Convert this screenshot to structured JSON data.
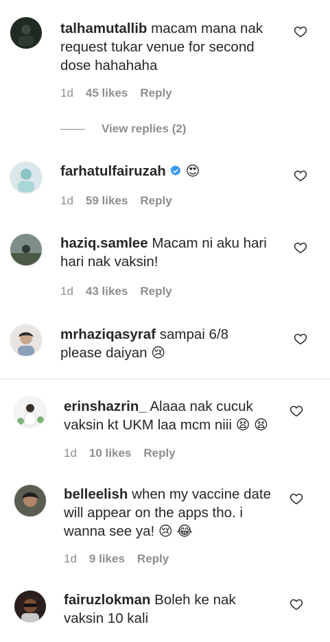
{
  "comments": [
    {
      "username": "talhamutallib",
      "text": "macam mana nak request tukar venue for second dose hahahaha",
      "age": "1d",
      "likes": "45 likes",
      "reply": "Reply",
      "view_replies": "View replies (2)"
    },
    {
      "username": "farhatulfairuzah",
      "text": "",
      "emoji": "😍",
      "age": "1d",
      "likes": "59 likes",
      "reply": "Reply"
    },
    {
      "username": "haziq.samlee",
      "text": "Macam ni aku hari hari nak vaksin!",
      "age": "1d",
      "likes": "43 likes",
      "reply": "Reply"
    },
    {
      "username": "mrhaziqasyraf",
      "text": "sampai 6/8 please daiyan",
      "emoji": "😢"
    },
    {
      "username": "erinshazrin_",
      "text": "Alaaa nak cucuk vaksin kt UKM laa mcm niii",
      "emoji": "😫 😫",
      "age": "1d",
      "likes": "10 likes",
      "reply": "Reply"
    },
    {
      "username": "belleelish",
      "text": "when my vaccine date will appear on the apps tho. i wanna see ya!",
      "emoji": "😢 😂",
      "age": "1d",
      "likes": "9 likes",
      "reply": "Reply"
    },
    {
      "username": "fairuzlokman",
      "text": "Boleh ke nak vaksin 10 kali"
    }
  ],
  "icons": {
    "like": "heart-outline-icon",
    "verified": "verified-badge-icon"
  },
  "colors": {
    "meta_grey": "#8e8e8e",
    "text": "#262626",
    "verified_blue": "#3897f0",
    "divider": "#dbdbdb"
  }
}
